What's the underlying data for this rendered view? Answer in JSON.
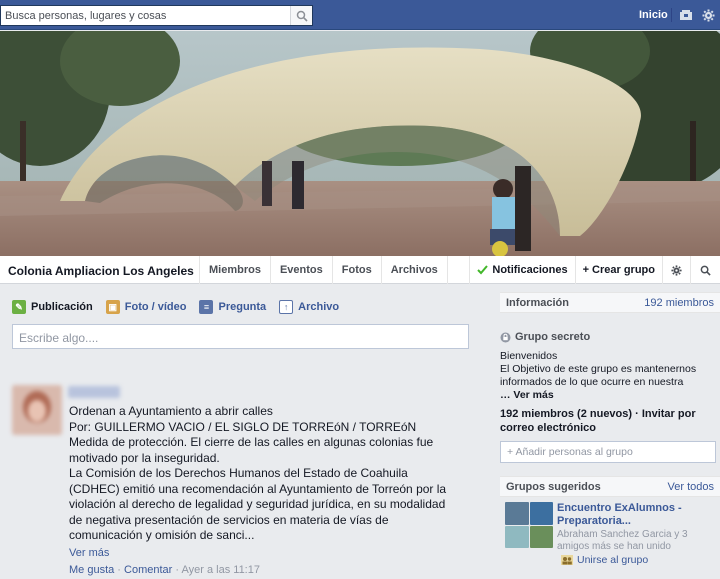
{
  "topbar": {
    "search_placeholder": "Busca personas, lugares y cosas",
    "home_label": "Inicio",
    "icons": [
      "search-icon",
      "friend-requests-icon",
      "settings-gear-icon"
    ]
  },
  "group": {
    "name": "Colonia Ampliacion Los Angeles",
    "tabs": [
      "Miembros",
      "Eventos",
      "Fotos",
      "Archivos"
    ],
    "notifications_label": "Notificaciones",
    "create_group_label": "+ Crear grupo"
  },
  "composer": {
    "tabs": [
      {
        "label": "Publicación",
        "icon": "post-icon"
      },
      {
        "label": "Foto / vídeo",
        "icon": "photo-icon"
      },
      {
        "label": "Pregunta",
        "icon": "question-icon"
      },
      {
        "label": "Archivo",
        "icon": "file-icon"
      }
    ],
    "placeholder": "Escribe algo...."
  },
  "post": {
    "lines": [
      "Ordenan a Ayuntamiento a abrir calles",
      "Por: GUILLERMO VACIO / EL SIGLO DE TORREóN / TORREóN",
      "Medida de protección. El cierre de las calles en algunas colonias fue motivado por la inseguridad.",
      "La Comisión de los Derechos Humanos del Estado de Coahuila (CDHEC) emitió una recomendación al Ayuntamiento de Torreón por la violación al derecho de legalidad y seguridad jurídica, en su modalidad de negativa presentación de servicios en materia de vías de comunicación y omisión de sanci..."
    ],
    "see_more": "Ver más",
    "like": "Me gusta",
    "sep": " · ",
    "comment": "Comentar",
    "time": "Ayer a las 11:17"
  },
  "sidebar": {
    "info_title": "Información",
    "members_count_link": "192 miembros",
    "secret_label": "Grupo secreto",
    "desc_line1": "Bienvenidos",
    "desc_line2": "El Objetivo de este grupo es mantenernos informados de lo que ocurre en nuestra",
    "desc_more": "… Ver más",
    "members_summary": "192 miembros  (2 nuevos) · Invitar por correo electrónico",
    "add_people_placeholder": "+ Añadir personas al grupo",
    "suggested_title": "Grupos sugeridos",
    "see_all": "Ver todos",
    "suggested_group": {
      "name": "Encuentro ExAlumnos - Preparatoria...",
      "members": "Abraham Sanchez Garcia y 3 amigos más se han unido",
      "join_label": "Unirse al grupo"
    }
  },
  "colors": {
    "brand_blue": "#3b5998",
    "link": "#3b5998",
    "green_check": "#42b72a"
  }
}
